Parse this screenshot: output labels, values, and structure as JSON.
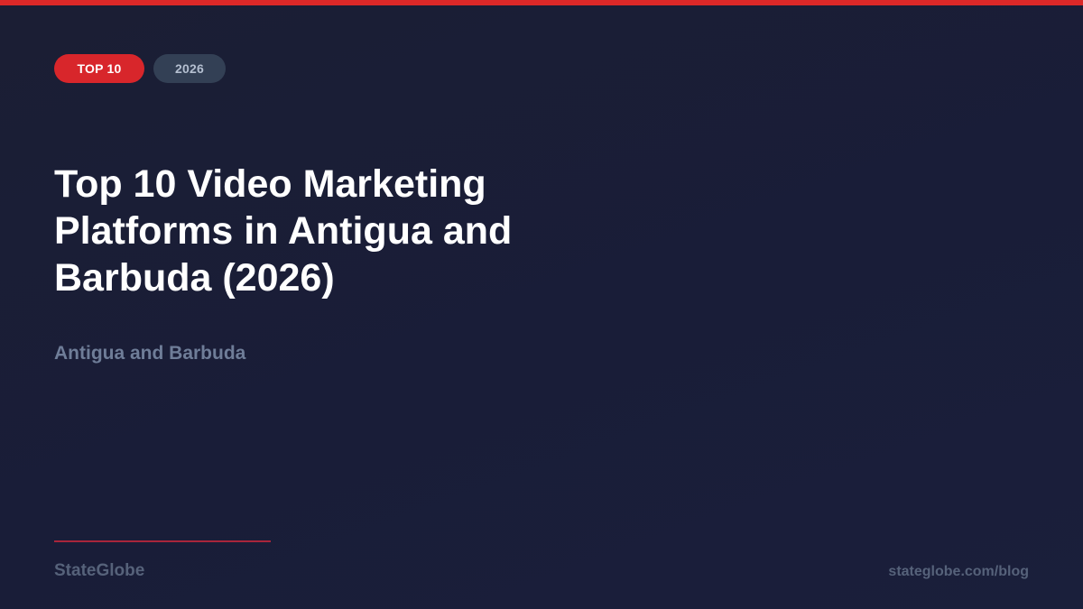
{
  "badges": {
    "primary": "TOP 10",
    "secondary": "2026"
  },
  "title": "Top 10 Video Marketing Platforms in Antigua and Barbuda (2026)",
  "subtitle": "Antigua and Barbuda",
  "footer": {
    "brand": "StateGlobe",
    "url": "stateglobe.com/blog"
  },
  "colors": {
    "accent": "#dc2828",
    "background": "#1b1e34",
    "badge_secondary": "#334055",
    "muted_text": "#6f7d98"
  }
}
